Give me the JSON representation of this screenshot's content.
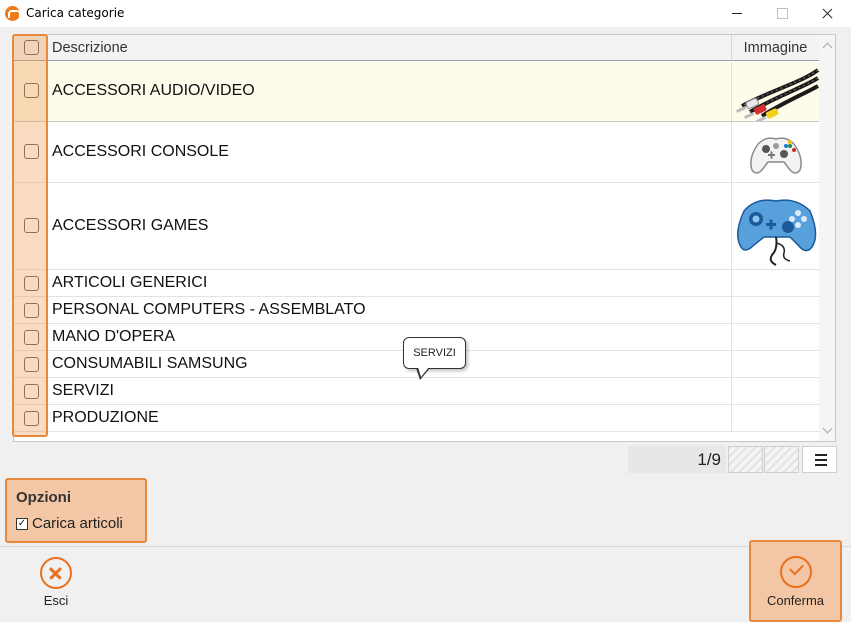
{
  "window": {
    "title": "Carica categorie"
  },
  "grid": {
    "columns": {
      "description": "Descrizione",
      "image": "Immagine"
    },
    "rows": [
      {
        "label": "ACCESSORI AUDIO/VIDEO",
        "image": "av-cables-image",
        "selected": true
      },
      {
        "label": "ACCESSORI CONSOLE",
        "image": "game-controller-image"
      },
      {
        "label": "ACCESSORI GAMES",
        "image": "blue-gamepad-image"
      },
      {
        "label": "ARTICOLI GENERICI"
      },
      {
        "label": "PERSONAL COMPUTERS - ASSEMBLATO"
      },
      {
        "label": "MANO D'OPERA"
      },
      {
        "label": "CONSUMABILI SAMSUNG"
      },
      {
        "label": "SERVIZI"
      },
      {
        "label": "PRODUZIONE"
      }
    ]
  },
  "tooltip": {
    "text": "SERVIZI"
  },
  "pager": {
    "count": "1/9"
  },
  "options": {
    "title": "Opzioni",
    "load_items_label": "Carica articoli",
    "load_items_checked": true
  },
  "footer": {
    "cancel_label": "Esci",
    "confirm_label": "Conferma"
  },
  "colors": {
    "accent": "#e8701e",
    "highlight": "#f3c7a5",
    "selected_row": "#fefbea"
  }
}
